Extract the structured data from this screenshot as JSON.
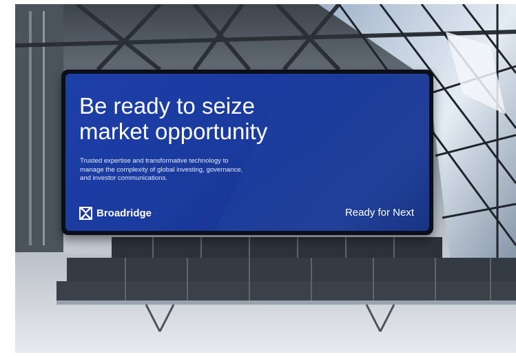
{
  "billboard": {
    "headline_line1": "Be ready to seize",
    "headline_line2": "market opportunity",
    "subcopy_line1": "Trusted expertise and transformative technology to",
    "subcopy_line2": "manage the complexity of global investing, governance,",
    "subcopy_line3": "and investor communications.",
    "brand_name": "Broadridge",
    "brand_mark": "·",
    "tagline": "Ready for Next"
  },
  "icons": {
    "brand_logo": "broadridge-logo-icon"
  },
  "colors": {
    "screen_blue": "#1c3fa8",
    "frame_dark": "#0b0f1a",
    "text_white": "#ffffff"
  }
}
